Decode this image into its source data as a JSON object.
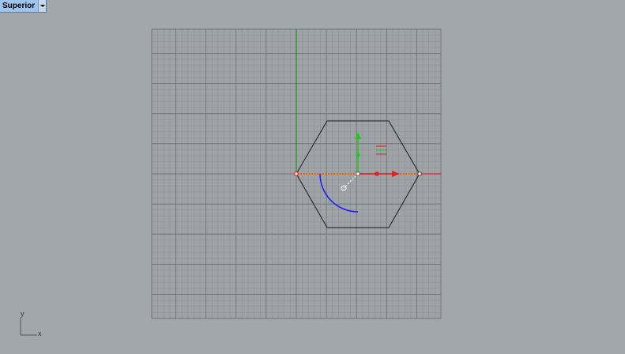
{
  "viewport": {
    "name": "Superior"
  },
  "axis_widget": {
    "x_label": "x",
    "y_label": "y"
  },
  "colors": {
    "background": "#a2a7ad",
    "grid_fill": "#9fa3a7",
    "grid_minor": "#8c9196",
    "grid_major": "#6e7378",
    "world_x_axis": "#e02020",
    "world_y_axis": "#1e8c1e",
    "hexagon": "#1a1a1a",
    "gumball_x": "#e02020",
    "gumball_y": "#19cc19",
    "gumball_rotate": "#1a1aff",
    "selected_edge": "#f0b000"
  }
}
